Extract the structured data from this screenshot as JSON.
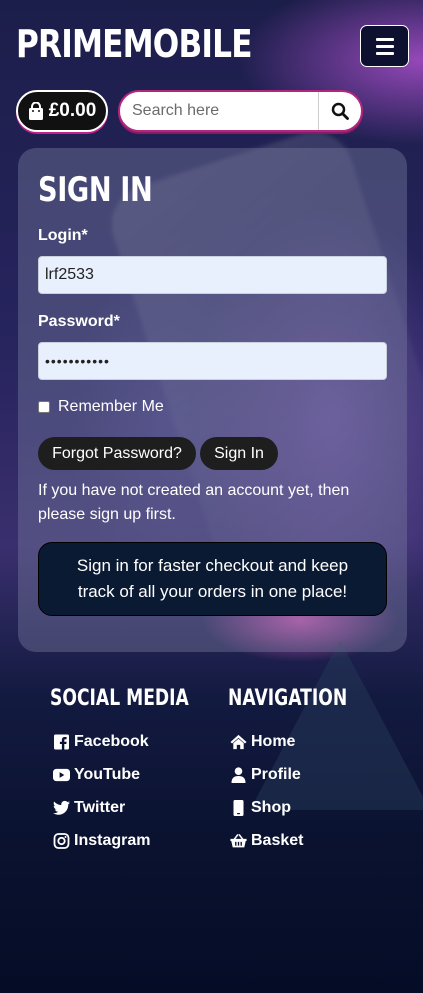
{
  "header": {
    "brand": "PRIMEMOBILE",
    "menu_icon": "hamburger-menu-icon"
  },
  "basket": {
    "icon": "shopping-bag-icon",
    "total": "£0.00"
  },
  "search": {
    "placeholder": "Search here",
    "icon": "search-icon"
  },
  "signin": {
    "title": "SIGN IN",
    "login_label": "Login*",
    "login_value": "lrf2533",
    "password_label": "Password*",
    "password_value": "•••••••••••",
    "remember_label": "Remember Me",
    "forgot_label": "Forgot Password?",
    "signin_label": "Sign In",
    "note": "If you have not created an account yet, then please sign up first.",
    "cta": "Sign in for faster checkout and keep track of all your orders in one place!"
  },
  "footer": {
    "social_title": "SOCIAL MEDIA",
    "social": [
      {
        "label": "Facebook",
        "icon": "facebook-icon"
      },
      {
        "label": "YouTube",
        "icon": "youtube-icon"
      },
      {
        "label": "Twitter",
        "icon": "twitter-icon"
      },
      {
        "label": "Instagram",
        "icon": "instagram-icon"
      }
    ],
    "nav_title": "NAVIGATION",
    "nav": [
      {
        "label": "Home",
        "icon": "home-icon"
      },
      {
        "label": "Profile",
        "icon": "user-icon"
      },
      {
        "label": "Shop",
        "icon": "mobile-phone-icon"
      },
      {
        "label": "Basket",
        "icon": "basket-icon"
      }
    ]
  },
  "colors": {
    "accent": "#c2208a",
    "dark_button": "#1e1e1e",
    "field_bg": "#e8f0fe"
  }
}
